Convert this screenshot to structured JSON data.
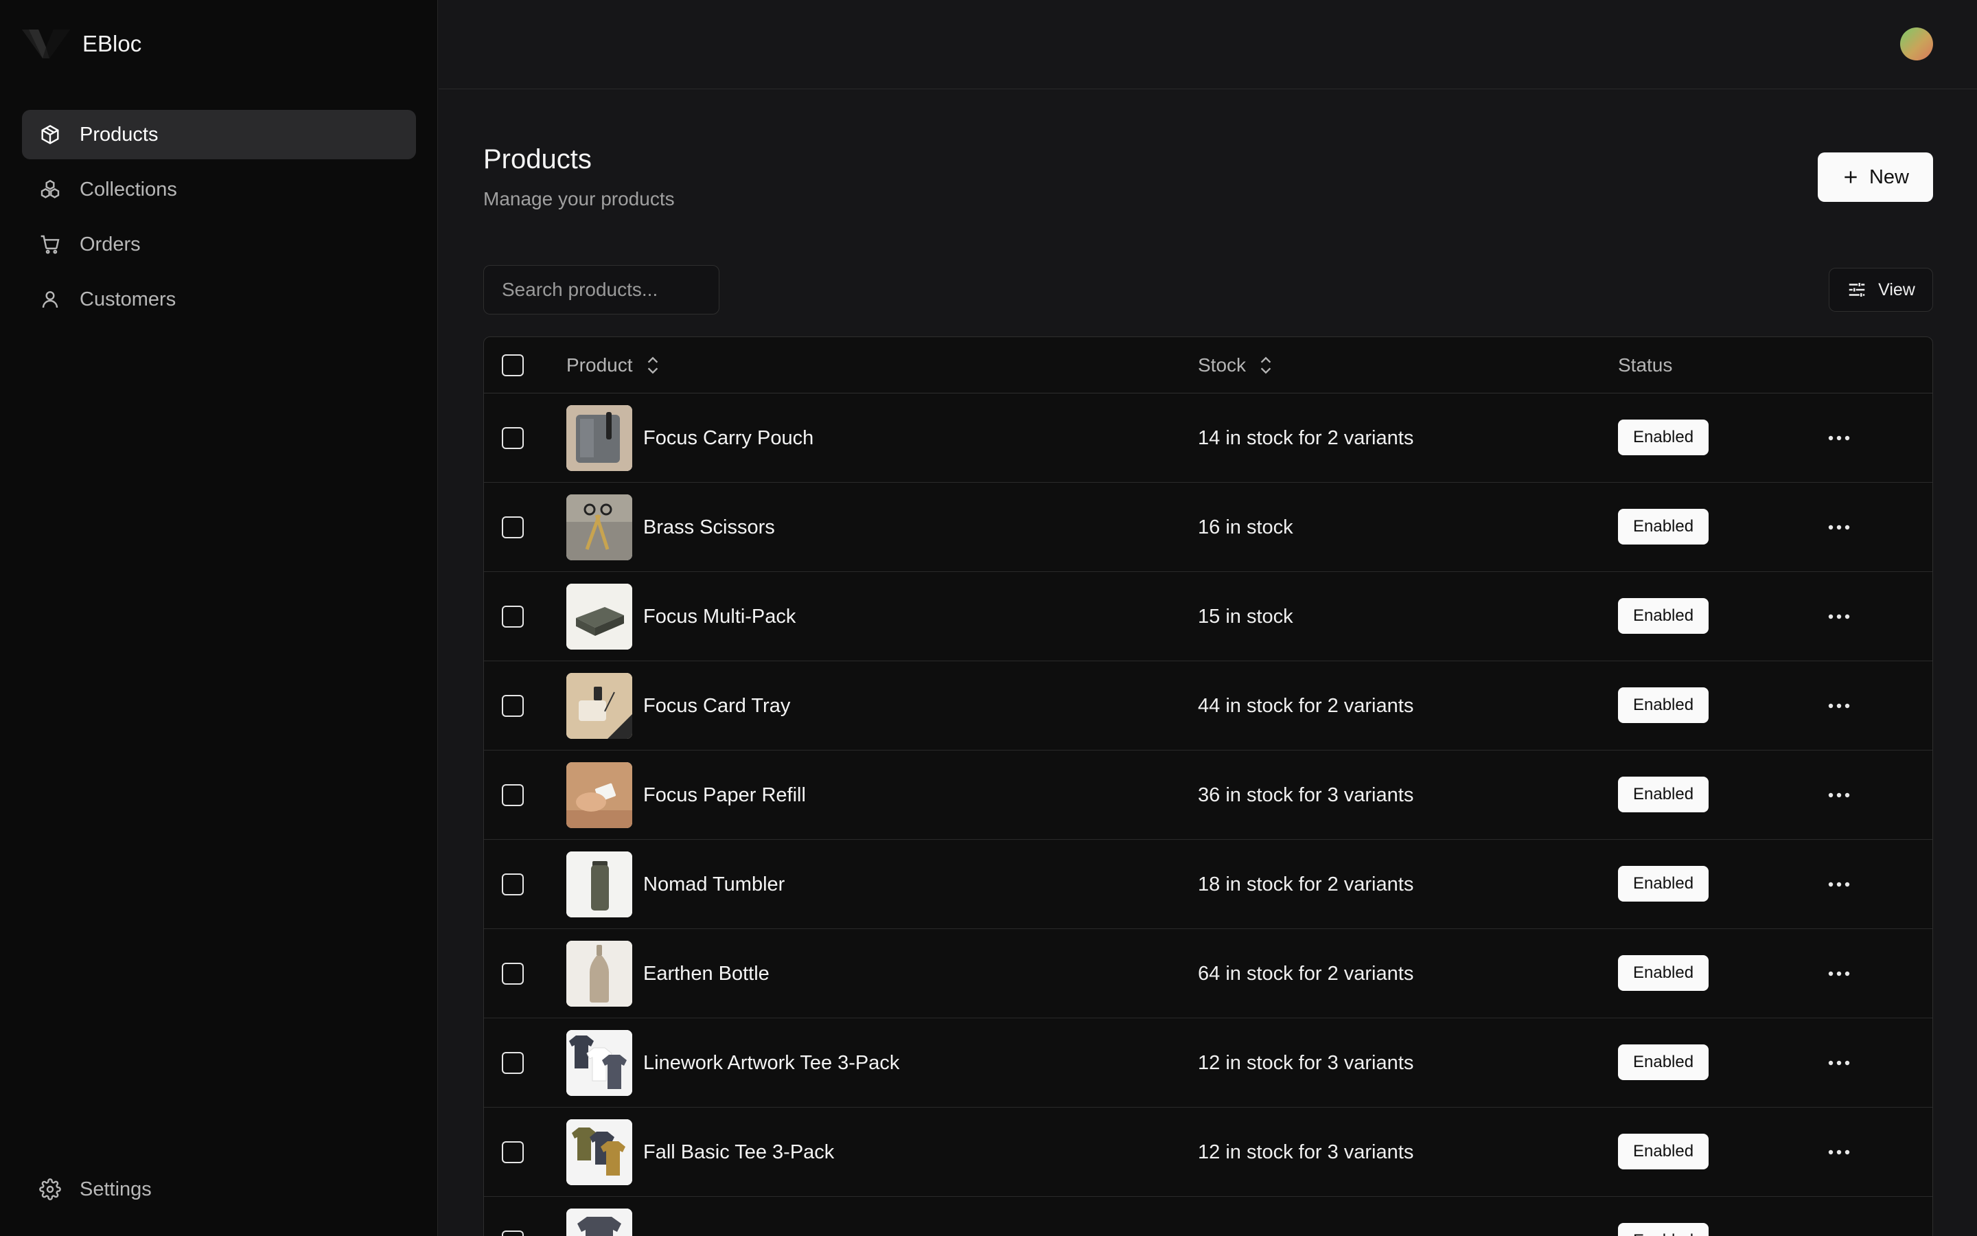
{
  "app": {
    "name": "EBloc"
  },
  "sidebar": {
    "items": [
      {
        "label": "Products",
        "icon": "package-icon",
        "active": true
      },
      {
        "label": "Collections",
        "icon": "collections-icon",
        "active": false
      },
      {
        "label": "Orders",
        "icon": "cart-icon",
        "active": false
      },
      {
        "label": "Customers",
        "icon": "user-icon",
        "active": false
      }
    ],
    "settings_label": "Settings"
  },
  "page": {
    "title": "Products",
    "subtitle": "Manage your products"
  },
  "toolbar": {
    "new_label": "New",
    "view_label": "View",
    "search_placeholder": "Search products..."
  },
  "table": {
    "columns": {
      "product": "Product",
      "stock": "Stock",
      "status": "Status"
    },
    "rows": [
      {
        "name": "Focus Carry Pouch",
        "stock": "14 in stock for 2 variants",
        "status": "Enabled"
      },
      {
        "name": "Brass Scissors",
        "stock": "16 in stock",
        "status": "Enabled"
      },
      {
        "name": "Focus Multi-Pack",
        "stock": "15 in stock",
        "status": "Enabled"
      },
      {
        "name": "Focus Card Tray",
        "stock": "44 in stock for 2 variants",
        "status": "Enabled"
      },
      {
        "name": "Focus Paper Refill",
        "stock": "36 in stock for 3 variants",
        "status": "Enabled"
      },
      {
        "name": "Nomad Tumbler",
        "stock": "18 in stock for 2 variants",
        "status": "Enabled"
      },
      {
        "name": "Earthen Bottle",
        "stock": "64 in stock for 2 variants",
        "status": "Enabled"
      },
      {
        "name": "Linework Artwork Tee 3-Pack",
        "stock": "12 in stock for 3 variants",
        "status": "Enabled"
      },
      {
        "name": "Fall Basic Tee 3-Pack",
        "stock": "12 in stock for 3 variants",
        "status": "Enabled"
      },
      {
        "name": "",
        "stock": "",
        "status": "Enabled"
      }
    ]
  },
  "colors": {
    "background": "#161618",
    "sidebar": "#0b0b0b",
    "accent": "#fafafa",
    "active_nav": "#2a2a2c"
  }
}
